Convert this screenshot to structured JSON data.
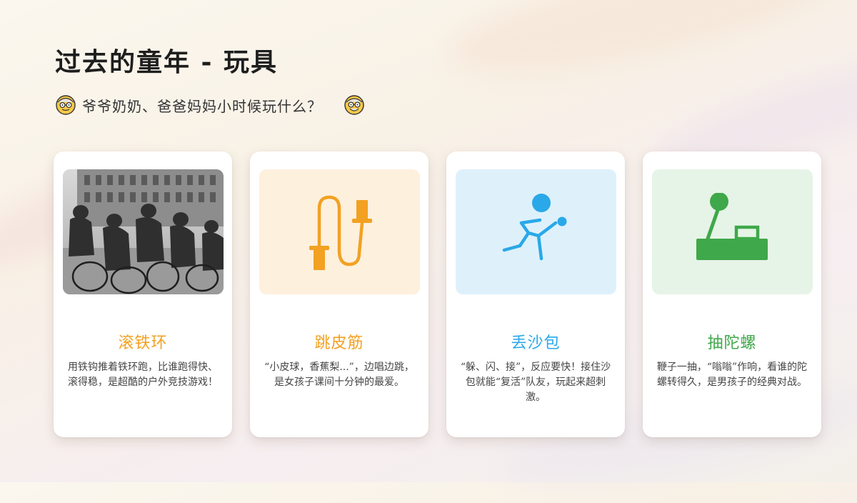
{
  "page": {
    "title": "过去的童年 - 玩具",
    "subtitle": "爷爷奶奶、爸爸妈妈小时候玩什么？",
    "left_icon": "grandparent-face-icon",
    "right_icon": "grandparent-face-icon"
  },
  "cards": [
    {
      "title": "滚铁环",
      "desc": "用铁钩推着铁环跑，比谁跑得快、滚得稳，是超酷的户外竞技游戏！",
      "accent": "#f2a122",
      "media": "photo",
      "icon": "children-rolling-hoops-photo"
    },
    {
      "title": "跳皮筋",
      "desc": "“小皮球，香蕉梨...”，边唱边跳，是女孩子课间十分钟的最爱。",
      "accent": "#f2a122",
      "bg": "#fdf0dd",
      "icon": "jump-rope-icon"
    },
    {
      "title": "丢沙包",
      "desc": "“躲、闪、接”，反应要快！接住沙包就能“复活”队友，玩起来超刺激。",
      "accent": "#2aa8e8",
      "bg": "#def1fb",
      "icon": "player-throwing-ball-icon"
    },
    {
      "title": "抽陀螺",
      "desc": "鞭子一抽，“嗡嗡”作响，看谁的陀螺转得久，是男孩子的经典对战。",
      "accent": "#3fa84a",
      "bg": "#e6f4e7",
      "icon": "spinning-top-whip-icon"
    }
  ]
}
